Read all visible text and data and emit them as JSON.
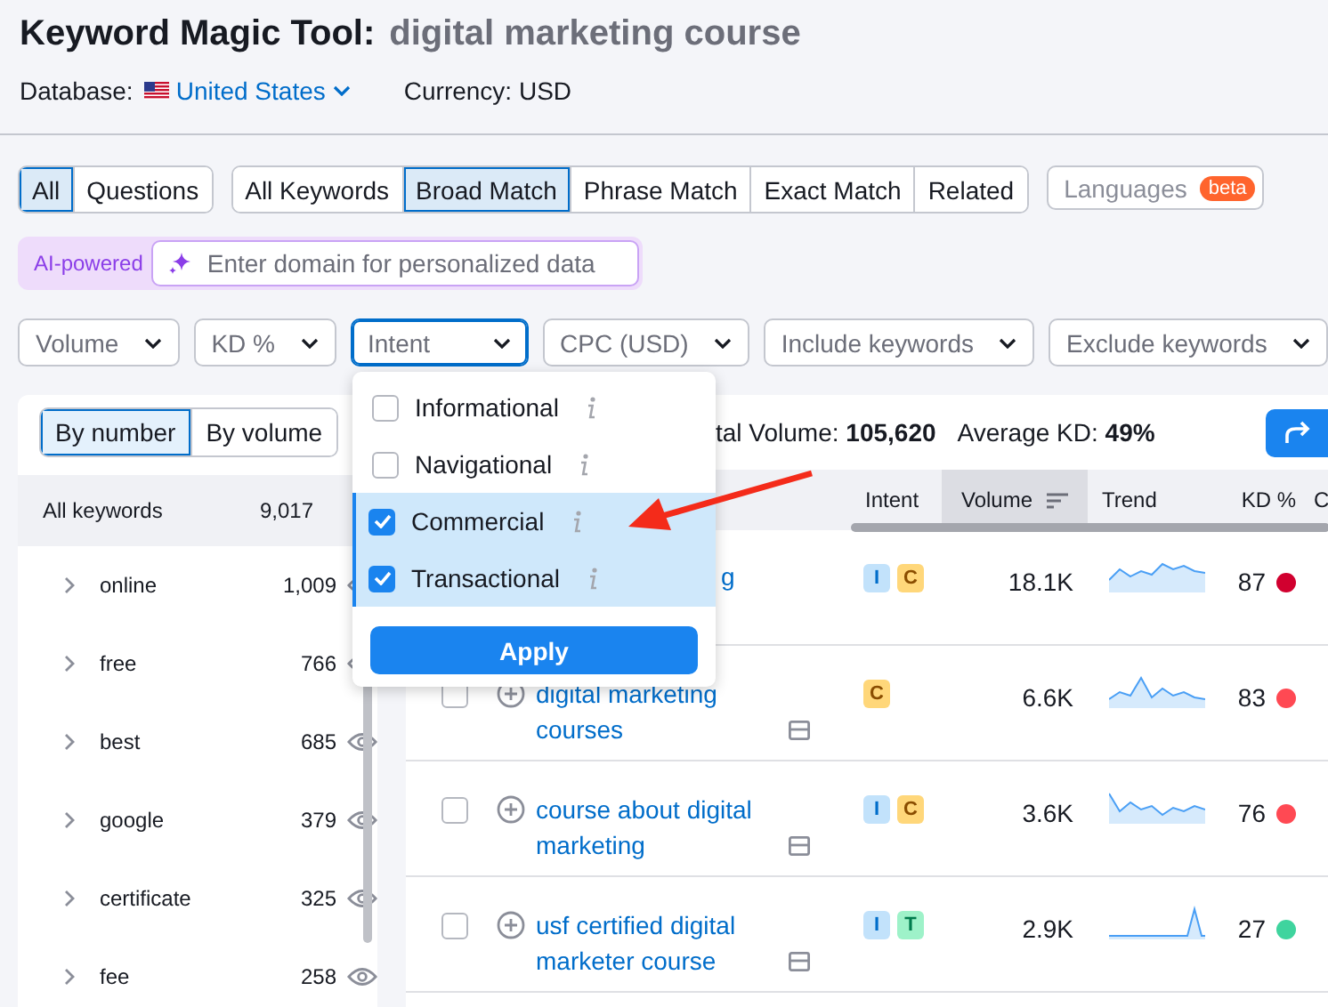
{
  "header": {
    "title": "Keyword Magic Tool:",
    "query": "digital marketing course",
    "database_label": "Database:",
    "database": "United States",
    "currency": "Currency: USD"
  },
  "question_tabs": [
    {
      "label": "All",
      "selected": true
    },
    {
      "label": "Questions",
      "selected": false
    }
  ],
  "match_tabs": [
    {
      "label": "All Keywords",
      "selected": false
    },
    {
      "label": "Broad Match",
      "selected": true
    },
    {
      "label": "Phrase Match",
      "selected": false
    },
    {
      "label": "Exact Match",
      "selected": false
    },
    {
      "label": "Related",
      "selected": false
    }
  ],
  "languages": {
    "label": "Languages",
    "badge": "beta"
  },
  "ai": {
    "badge": "AI-powered",
    "placeholder": "Enter domain for personalized data"
  },
  "filters": [
    {
      "label": "Volume",
      "open": false
    },
    {
      "label": "KD %",
      "open": false
    },
    {
      "label": "Intent",
      "open": true
    },
    {
      "label": "CPC (USD)",
      "open": false
    },
    {
      "label": "Include keywords",
      "open": false
    },
    {
      "label": "Exclude keywords",
      "open": false
    }
  ],
  "intent_menu": {
    "options": [
      {
        "label": "Informational",
        "checked": false
      },
      {
        "label": "Navigational",
        "checked": false
      },
      {
        "label": "Commercial",
        "checked": true
      },
      {
        "label": "Transactional",
        "checked": true
      }
    ],
    "apply": "Apply"
  },
  "groups": {
    "tabs": [
      {
        "label": "By number",
        "selected": true
      },
      {
        "label": "By volume",
        "selected": false
      }
    ],
    "all_label": "All keywords",
    "all_count": "9,017",
    "items": [
      {
        "name": "online",
        "count": "1,009"
      },
      {
        "name": "free",
        "count": "766"
      },
      {
        "name": "best",
        "count": "685"
      },
      {
        "name": "google",
        "count": "379"
      },
      {
        "name": "certificate",
        "count": "325"
      },
      {
        "name": "fee",
        "count": "258"
      }
    ]
  },
  "summary": {
    "volume_label": "tal Volume:",
    "volume": "105,620",
    "kd_label": "Average KD:",
    "kd": "49%"
  },
  "columns": [
    {
      "label": "Intent",
      "sorted": false
    },
    {
      "label": "Volume",
      "sorted": true
    },
    {
      "label": "Trend",
      "sorted": false
    },
    {
      "label": "KD %",
      "sorted": false
    },
    {
      "label": "C",
      "sorted": false
    }
  ],
  "rows": [
    {
      "kind": "partial",
      "keyword": "g",
      "intents": [
        {
          "letter": "I",
          "color": "#c2e2fb"
        },
        {
          "letter": "C",
          "color": "#ffd77a"
        }
      ],
      "volume": "18.1K",
      "kd": "87",
      "color": "#d1002f"
    },
    {
      "kind": "full",
      "checked": false,
      "keyword": "digital marketing courses",
      "intents": [
        {
          "letter": "C",
          "color": "#ffd77a"
        }
      ],
      "volume": "6.6K",
      "kd": "83",
      "color": "#ff4953"
    },
    {
      "kind": "full",
      "checked": false,
      "keyword": "course about digital marketing",
      "intents": [
        {
          "letter": "I",
          "color": "#c2e2fb"
        },
        {
          "letter": "C",
          "color": "#ffd77a"
        }
      ],
      "volume": "3.6K",
      "kd": "76",
      "color": "#ff4953"
    },
    {
      "kind": "full",
      "checked": false,
      "keyword": "usf certified digital marketer course",
      "intents": [
        {
          "letter": "I",
          "color": "#c2e2fb"
        },
        {
          "letter": "T",
          "color": "#9ef2c9"
        }
      ],
      "volume": "2.9K",
      "kd": "27",
      "color": "#3fd49e"
    }
  ]
}
